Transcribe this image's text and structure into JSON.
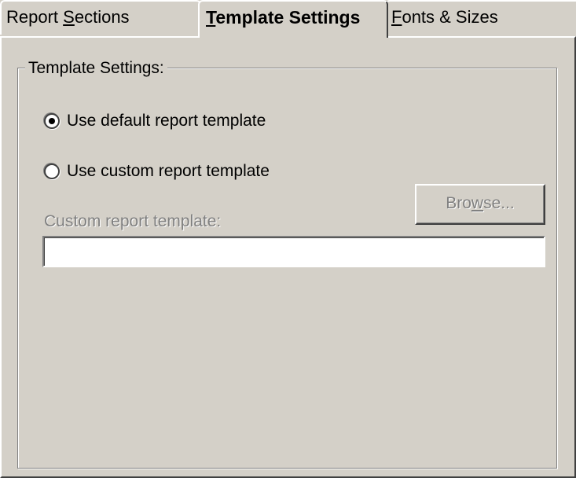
{
  "tabs": [
    {
      "label_pre": "Report ",
      "label_accel": "S",
      "label_post": "ections"
    },
    {
      "label_pre": "",
      "label_accel": "T",
      "label_post": "emplate Settings"
    },
    {
      "label_pre": "",
      "label_accel": "F",
      "label_post": "onts & Sizes"
    }
  ],
  "active_tab": "Template Settings",
  "group": {
    "title": "Template Settings:"
  },
  "options": {
    "default_label": "Use default report template",
    "default_selected": true,
    "custom_label": "Use custom report template",
    "custom_selected": false
  },
  "browse": {
    "label_pre": "Bro",
    "label_accel": "w",
    "label_post": "se...",
    "enabled": false
  },
  "custom_template": {
    "label": "Custom report template:",
    "value": "",
    "enabled": true
  },
  "colors": {
    "face": "#d4d0c8",
    "disabled_text": "#808080"
  }
}
